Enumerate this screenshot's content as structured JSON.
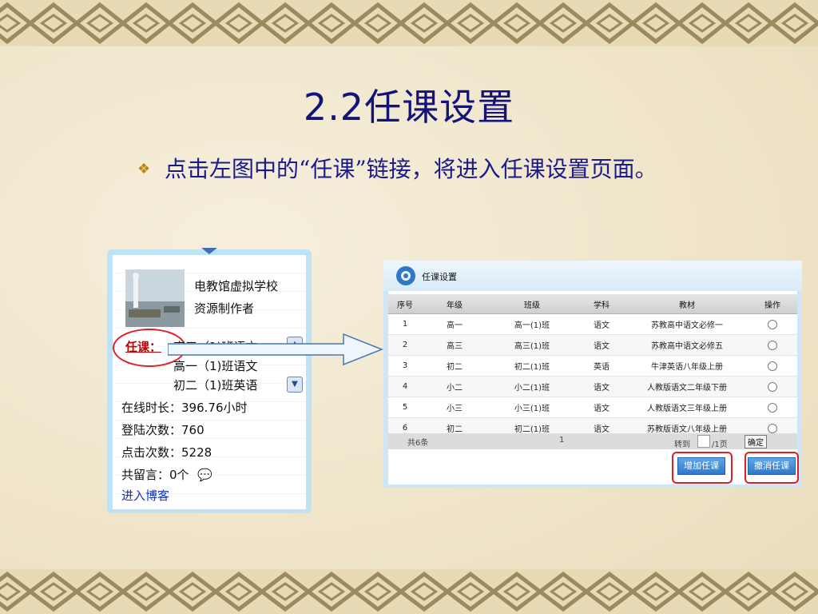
{
  "slide": {
    "title": "2.2任课设置",
    "bullet": "点击左图中的“任课”链接，将进入任课设置页面。"
  },
  "left_widget": {
    "school": "电教馆虚拟学校",
    "role": "资源制作者",
    "renke_label": "任课：",
    "classes": [
      "高三（1)班语文",
      "高一（1)班语文",
      "初二（1)班英语"
    ],
    "online_time": "在线时长：396.76小时",
    "login_count": "登陆次数：760",
    "click_count": "点击次数：5228",
    "messages": "共留言：0个",
    "blog_link": "进入博客"
  },
  "panel": {
    "title": "任课设置",
    "columns": [
      "序号",
      "年级",
      "班级",
      "学科",
      "教材",
      "操作"
    ],
    "rows": [
      {
        "no": "1",
        "grade": "高一",
        "class": "高一(1)班",
        "subject": "语文",
        "book": "苏教高中语文必修一"
      },
      {
        "no": "2",
        "grade": "高三",
        "class": "高三(1)班",
        "subject": "语文",
        "book": "苏教高中语文必修五"
      },
      {
        "no": "3",
        "grade": "初二",
        "class": "初二(1)班",
        "subject": "英语",
        "book": "牛津英语八年级上册"
      },
      {
        "no": "4",
        "grade": "小二",
        "class": "小二(1)班",
        "subject": "语文",
        "book": "人教版语文二年级下册"
      },
      {
        "no": "5",
        "grade": "小三",
        "class": "小三(1)班",
        "subject": "语文",
        "book": "人教版语文三年级上册"
      },
      {
        "no": "6",
        "grade": "初二",
        "class": "初二(1)班",
        "subject": "语文",
        "book": "苏教版语文八年级上册"
      }
    ],
    "total": "共6条",
    "page": "1",
    "goto_label": "转到",
    "per_page": "/1页",
    "confirm": "确定",
    "add_button": "增加任课",
    "cancel_button": "撤消任课"
  }
}
